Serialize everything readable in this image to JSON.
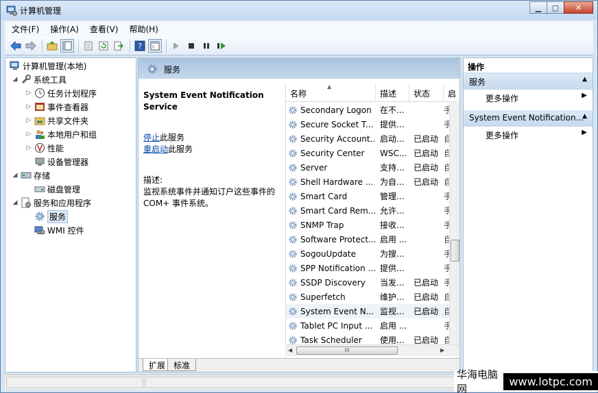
{
  "window": {
    "title": "计算机管理",
    "icon": "computer-management-icon",
    "controls": [
      "minimize",
      "maximize",
      "close"
    ]
  },
  "menu": [
    "文件(F)",
    "操作(A)",
    "查看(V)",
    "帮助(H)"
  ],
  "toolbar": [
    "back-arrow-icon",
    "forward-arrow-icon",
    "up-folder-icon",
    "console-tree-icon",
    "properties-icon",
    "refresh-icon",
    "export-icon",
    "help-icon",
    "view-icon",
    "play-icon",
    "stop-icon",
    "pause-icon",
    "restart-icon"
  ],
  "tree": {
    "root": "计算机管理(本地)",
    "items": [
      {
        "label": "系统工具",
        "level": 1,
        "expander": "open"
      },
      {
        "label": "任务计划程序",
        "level": 2,
        "expander": "closed"
      },
      {
        "label": "事件查看器",
        "level": 2,
        "expander": "closed"
      },
      {
        "label": "共享文件夹",
        "level": 2,
        "expander": "closed"
      },
      {
        "label": "本地用户和组",
        "level": 2,
        "expander": "closed"
      },
      {
        "label": "性能",
        "level": 2,
        "expander": "closed"
      },
      {
        "label": "设备管理器",
        "level": 2,
        "expander": "none"
      },
      {
        "label": "存储",
        "level": 1,
        "expander": "open"
      },
      {
        "label": "磁盘管理",
        "level": 2,
        "expander": "none"
      },
      {
        "label": "服务和应用程序",
        "level": 1,
        "expander": "open"
      },
      {
        "label": "服务",
        "level": 2,
        "expander": "none",
        "selected": true
      },
      {
        "label": "WMI 控件",
        "level": 2,
        "expander": "none"
      }
    ]
  },
  "center": {
    "header": "服务",
    "selected_service": "System Event Notification Service",
    "stop_link": "停止",
    "stop_suffix": "此服务",
    "restart_link": "重启动",
    "restart_suffix": "此服务",
    "desc_label": "描述:",
    "desc_text": "监视系统事件并通知订户这些事件的 COM+ 事件系统。",
    "columns": [
      "名称",
      "描述",
      "状态",
      "启"
    ],
    "services": [
      {
        "name": "Secondary Logon",
        "desc": "在不...",
        "state": "",
        "extra": "手"
      },
      {
        "name": "Secure Socket T...",
        "desc": "提供...",
        "state": "",
        "extra": "手"
      },
      {
        "name": "Security Account...",
        "desc": "启动...",
        "state": "已启动",
        "extra": "自"
      },
      {
        "name": "Security Center",
        "desc": "WSC...",
        "state": "已启动",
        "extra": "自"
      },
      {
        "name": "Server",
        "desc": "支持...",
        "state": "已启动",
        "extra": "自"
      },
      {
        "name": "Shell Hardware ...",
        "desc": "为自...",
        "state": "已启动",
        "extra": "自"
      },
      {
        "name": "Smart Card",
        "desc": "管理...",
        "state": "",
        "extra": "手"
      },
      {
        "name": "Smart Card Rem...",
        "desc": "允许...",
        "state": "",
        "extra": "手"
      },
      {
        "name": "SNMP Trap",
        "desc": "接收...",
        "state": "",
        "extra": "手"
      },
      {
        "name": "Software Protect...",
        "desc": "启用 ...",
        "state": "",
        "extra": "自"
      },
      {
        "name": "SogouUpdate",
        "desc": "为搜...",
        "state": "",
        "extra": "手"
      },
      {
        "name": "SPP Notification ...",
        "desc": "提供...",
        "state": "",
        "extra": "手"
      },
      {
        "name": "SSDP Discovery",
        "desc": "当发...",
        "state": "已启动",
        "extra": "手"
      },
      {
        "name": "Superfetch",
        "desc": "维护...",
        "state": "已启动",
        "extra": "自"
      },
      {
        "name": "System Event N...",
        "desc": "监视...",
        "state": "已启动",
        "extra": "自",
        "highlight": true
      },
      {
        "name": "Tablet PC Input ...",
        "desc": "启用 ...",
        "state": "",
        "extra": "手"
      },
      {
        "name": "Task Scheduler",
        "desc": "使用...",
        "state": "已启动",
        "extra": "自"
      }
    ],
    "tabs": [
      "扩展",
      "标准"
    ],
    "hscroll_grip": "III"
  },
  "actions": {
    "title": "操作",
    "sections": [
      {
        "label": "服务",
        "item": "更多操作"
      },
      {
        "label": "System Event Notification...",
        "item": "更多操作"
      }
    ]
  },
  "watermark": {
    "cn": "华海电脑网",
    "url": "www.lotpc.com"
  },
  "colors": {
    "title_bg": "#c4d9f1",
    "header_bg": "#aac4df",
    "link": "#0645ad",
    "close_btn": "#c7432b"
  }
}
